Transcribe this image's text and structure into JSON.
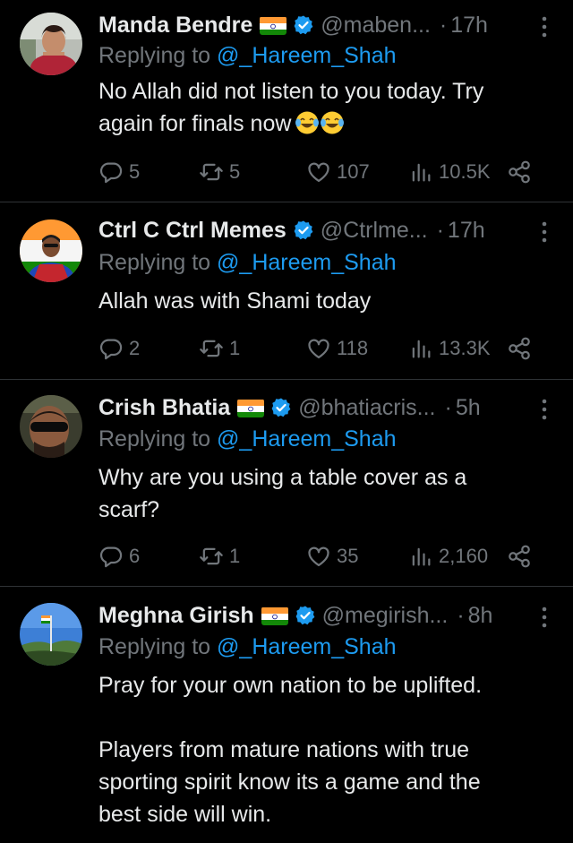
{
  "colors": {
    "background": "#000000",
    "text": "#e7e9ea",
    "muted": "#71767b",
    "link": "#1d9bf0",
    "verified": "#1d9bf0"
  },
  "tweets": [
    {
      "name": "Manda Bendre",
      "has_flag": true,
      "handle": "@maben...",
      "dot": "·",
      "time": "17h",
      "reply_prefix": "Replying to",
      "reply_mention": "@_Hareem_Shah",
      "body_lines": [
        "No Allah did not listen to you today. Try",
        "again for finals now"
      ],
      "body_emoji": [
        "laughing-tears-emoji",
        "laughing-tears-emoji"
      ],
      "stats": {
        "replies": "5",
        "retweets": "5",
        "likes": "107",
        "views": "10.5K"
      }
    },
    {
      "name": "Ctrl C Ctrl Memes",
      "has_flag": false,
      "handle": "@Ctrlme...",
      "dot": "·",
      "time": "17h",
      "reply_prefix": "Replying to",
      "reply_mention": "@_Hareem_Shah",
      "body_lines": [
        "Allah was with Shami today"
      ],
      "stats": {
        "replies": "2",
        "retweets": "1",
        "likes": "118",
        "views": "13.3K"
      }
    },
    {
      "name": "Crish Bhatia",
      "has_flag": true,
      "handle": "@bhatiacris...",
      "dot": "·",
      "time": "5h",
      "reply_prefix": "Replying to",
      "reply_mention": "@_Hareem_Shah",
      "body_lines": [
        "Why are you using a table cover as a",
        "scarf?"
      ],
      "stats": {
        "replies": "6",
        "retweets": "1",
        "likes": "35",
        "views": "2,160"
      }
    },
    {
      "name": "Meghna Girish",
      "has_flag": true,
      "handle": "@megirish...",
      "dot": "·",
      "time": "8h",
      "reply_prefix": "Replying to",
      "reply_mention": "@_Hareem_Shah",
      "body_lines": [
        "Pray for your own nation to be uplifted.",
        "",
        "Players from mature nations with true",
        "sporting spirit know its a game and the",
        "best side will win."
      ]
    }
  ]
}
